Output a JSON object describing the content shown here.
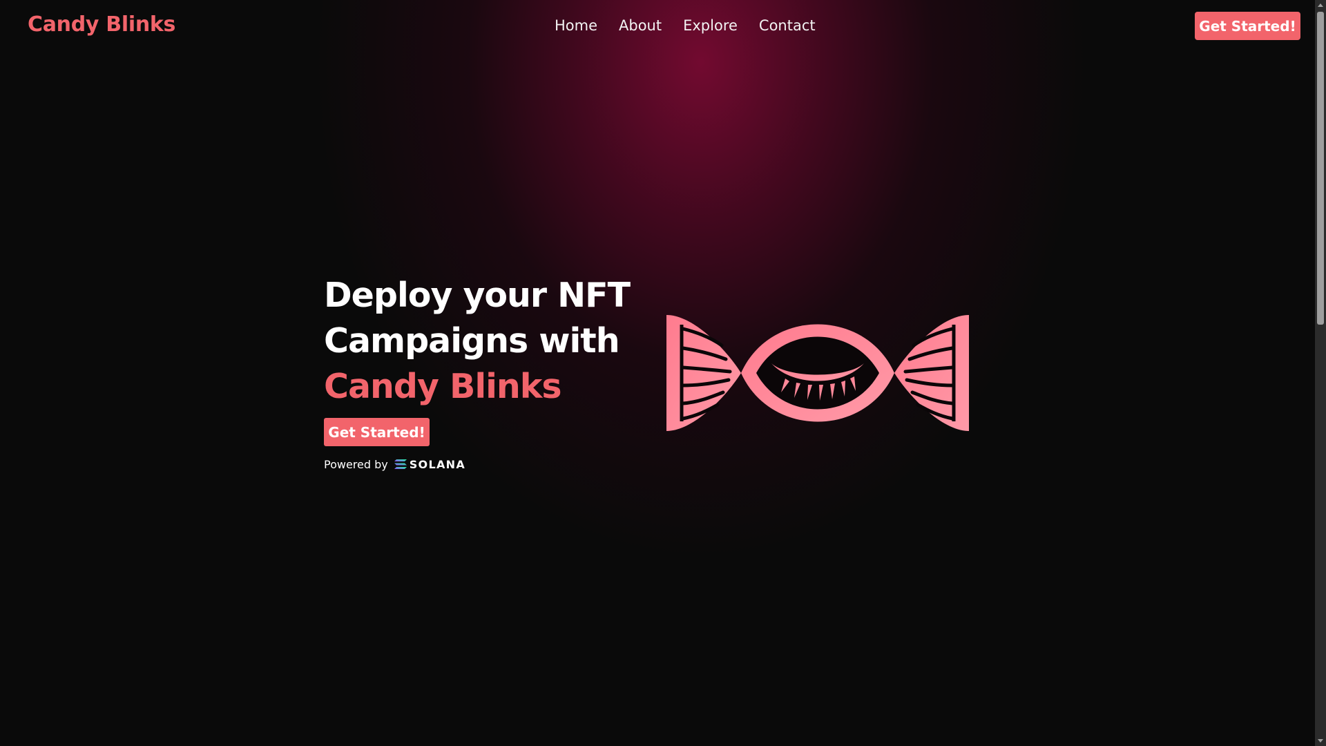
{
  "brand": {
    "name": "Candy Blinks"
  },
  "nav": {
    "links": [
      {
        "label": "Home"
      },
      {
        "label": "About"
      },
      {
        "label": "Explore"
      },
      {
        "label": "Contact"
      }
    ],
    "cta_label": "Get Started!"
  },
  "hero": {
    "title_line1": "Deploy your NFT",
    "title_line2": "Campaigns with",
    "title_accent": "Candy Blinks",
    "cta_label": "Get Started!",
    "powered_by_label": "Powered by",
    "powered_by_brand": "SOLANA",
    "illustration": "candy-eye-icon"
  },
  "colors": {
    "accent": "#f2646b",
    "logo_pink": "#ff8a9c",
    "background": "#0a0a0a",
    "glow": "#780a32"
  }
}
